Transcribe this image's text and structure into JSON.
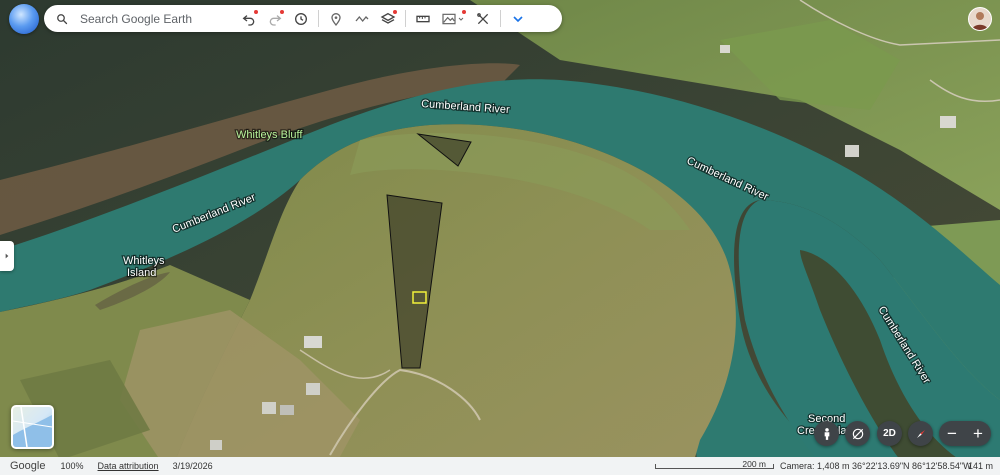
{
  "search": {
    "placeholder": "Search Google Earth"
  },
  "map": {
    "labels": {
      "river_top": "Cumberland River",
      "river_right": "Cumberland River",
      "river_left": "Cumberland River",
      "river_far_right": "Cumberland River",
      "bluff": "Whitleys Bluff",
      "island_line1": "Whitleys",
      "island_line2": "Island",
      "creek_line1": "Second",
      "creek_line2": "Creek Island"
    }
  },
  "controls": {
    "two_d_label": "2D",
    "zoom_in": "+",
    "zoom_out": "−"
  },
  "status": {
    "brand": "Google",
    "zoom_pct": "100%",
    "attribution": "Data attribution",
    "date": "3/19/2026",
    "scale": "200 m",
    "camera": "Camera: 1,408 m",
    "coords": "36°22'13.69\"N 86°12'58.54\"W",
    "elevation": "141 m"
  },
  "colors": {
    "river": "#2e7a70",
    "field": "#8b8f52",
    "accent_red": "#e53935"
  }
}
